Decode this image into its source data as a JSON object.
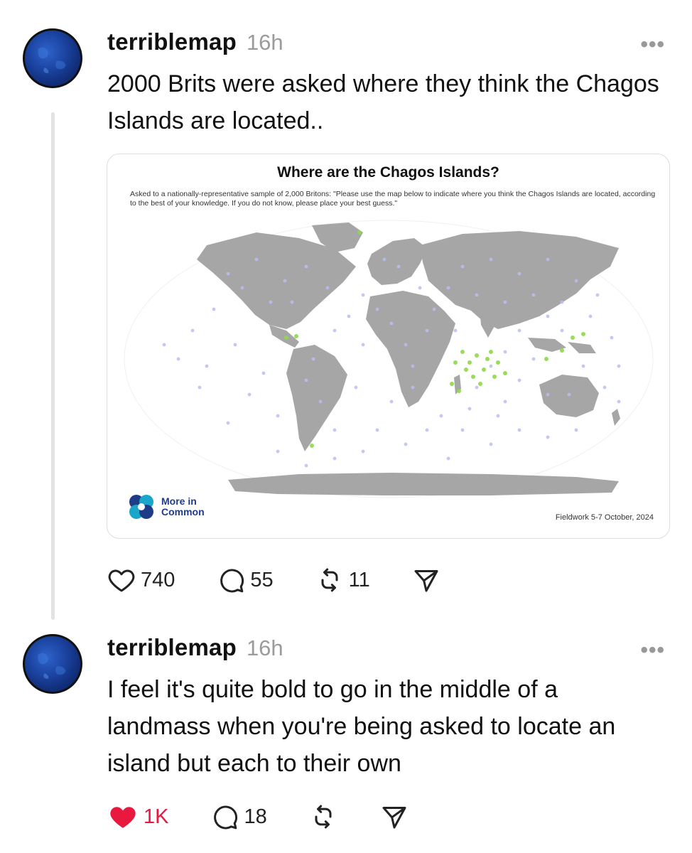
{
  "posts": [
    {
      "username": "terriblemap",
      "time": "16h",
      "more": "•••",
      "text": "2000 Brits were asked where they think the Chagos Islands are located..",
      "media": {
        "title": "Where are the Chagos Islands?",
        "subtitle": "Asked to a nationally-representative sample of 2,000 Britons: \"Please use the map below to indicate where you think the Chagos Islands are located, according to the best of your knowledge. If you do not know, please place your best guess.\"",
        "logo_text": "More in Common",
        "fieldwork": "Fieldwork 5-7 October, 2024"
      },
      "likes": "740",
      "replies": "55",
      "reposts": "11",
      "liked": false
    },
    {
      "username": "terriblemap",
      "time": "16h",
      "more": "•••",
      "text": "I feel it's quite bold to go in the middle of a landmass when you're being asked to locate an island but each to their own",
      "likes": "1K",
      "replies": "18",
      "reposts": "",
      "liked": true
    }
  ],
  "colors": {
    "like_red": "#e8183e",
    "land": "#a6a6a6",
    "dot": "#b9bff0",
    "hot_dot": "#8fd84a",
    "logo_blue": "#1f3c88",
    "logo_teal": "#19a6c8"
  },
  "icons": {
    "like": "heart-icon",
    "reply": "speech-bubble-icon",
    "repost": "repost-arrows-icon",
    "share": "paper-plane-icon"
  }
}
